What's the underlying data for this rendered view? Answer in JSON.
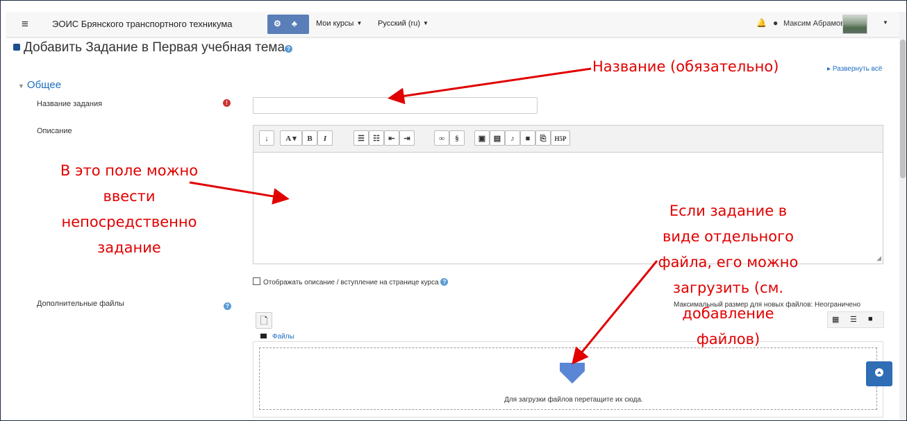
{
  "navbar": {
    "site_name": "ЭОИС Брянского транспортного техникума",
    "my_courses": "Мои курсы",
    "language": "Русский ‎(ru)‎",
    "user_name": "Максим Абрамов"
  },
  "page": {
    "title": "Добавить Задание в Первая учебная тема",
    "expand_all": "Развернуть всё",
    "section_general": "Общее"
  },
  "form": {
    "assignment_name_label": "Название задания",
    "assignment_name_value": "",
    "description_label": "Описание",
    "show_description_label": "Отображать описание / вступление на странице курса",
    "additional_files_label": "Дополнительные файлы",
    "max_size_label": "Максимальный размер для новых файлов: Неограничено",
    "files_folder": "Файлы",
    "drop_text": "Для загрузки файлов перетащите их сюда."
  },
  "annotations": {
    "name_required": "Название (обязательно)",
    "description_lines": [
      "В это поле можно",
      "ввести",
      "непосредственно",
      "задание"
    ],
    "files_lines": [
      "Если задание в",
      "виде отдельного",
      "файла, его можно",
      "загрузить (см.",
      "добавление",
      "файлов)"
    ],
    "color": "#e00000"
  },
  "colors": {
    "accent": "#1d6ec0",
    "toolbar_blue": "#5a7fb8",
    "back_to_top": "#2f6db5"
  }
}
